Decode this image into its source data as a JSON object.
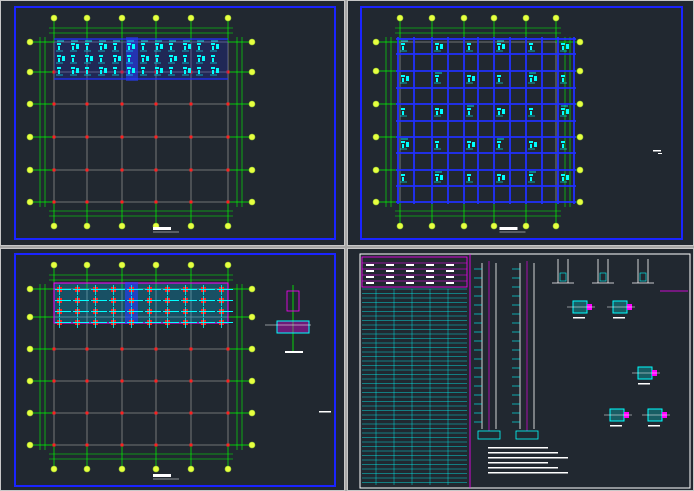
{
  "colors": {
    "background": "#212830",
    "frame": "#1a24ff",
    "axis_line": "#00ff00",
    "grid_line": "#8c8c8c",
    "column": "#ff2020",
    "beam": "#2030ff",
    "rebar": "#00ffff",
    "highlight": "#ff00ff",
    "title_text": "#ffffff"
  },
  "viewports": [
    {
      "name": "top-left-drawing",
      "content": "foundation-plan"
    },
    {
      "name": "top-right-drawing",
      "content": "beam-grid-plan"
    },
    {
      "name": "bottom-left-drawing",
      "content": "column-plan"
    },
    {
      "name": "bottom-right-drawing",
      "content": "schedule-and-details"
    }
  ]
}
